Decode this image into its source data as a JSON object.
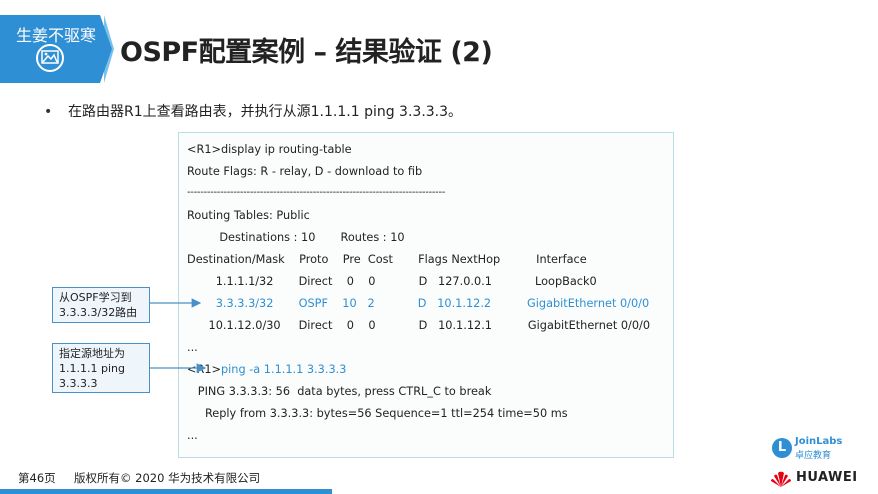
{
  "header": {
    "slogan": "生姜不驱寒",
    "title": "OSPF配置案例 – 结果验证 (2)"
  },
  "bullet": {
    "text": "在路由器R1上查看路由表，并执行从源1.1.1.1 ping 3.3.3.3。"
  },
  "terminal": {
    "lines": [
      "<R1>display ip routing-table",
      "Route Flags: R - relay, D - download to fib",
      "------------------------------------------------------------------------------",
      "Routing Tables: Public",
      "         Destinations : 10       Routes : 10",
      "Destination/Mask    Proto    Pre  Cost       Flags NextHop          Interface",
      "        1.1.1.1/32       Direct    0    0            D   127.0.0.1            LoopBack0",
      "        3.3.3.3/32       OSPF    10   2            D   10.1.12.2          GigabitEthernet 0/0/0",
      "      10.1.12.0/30     Direct    0    0            D   10.1.12.1          GigabitEthernet 0/0/0",
      "...",
      "<R1>",
      "   PING 3.3.3.3: 56  data bytes, press CTRL_C to break",
      "     Reply from 3.3.3.3: bytes=56 Sequence=1 ttl=254 time=50 ms",
      "..."
    ],
    "ping_command": "ping -a 1.1.1.1 3.3.3.3"
  },
  "callouts": {
    "ospf_learned": {
      "line1": "从OSPF学习到",
      "line2": "3.3.3.3/32路由"
    },
    "source_address": {
      "line1": "指定源地址为",
      "line2": "1.1.1.1 ping",
      "line3": "3.3.3.3"
    }
  },
  "footer": {
    "page": "第46页",
    "copyright": "版权所有© 2020 华为技术有限公司",
    "joinlabs_name": "JoinLabs",
    "joinlabs_sub": "卓应教育",
    "joinlabs_letter": "L",
    "huawei": "HUAWEI"
  },
  "colors": {
    "accent": "#2e8fd4",
    "highlight_text": "#2e8fd4",
    "callout_border": "#4a90c8",
    "huawei_red": "#e60012"
  }
}
